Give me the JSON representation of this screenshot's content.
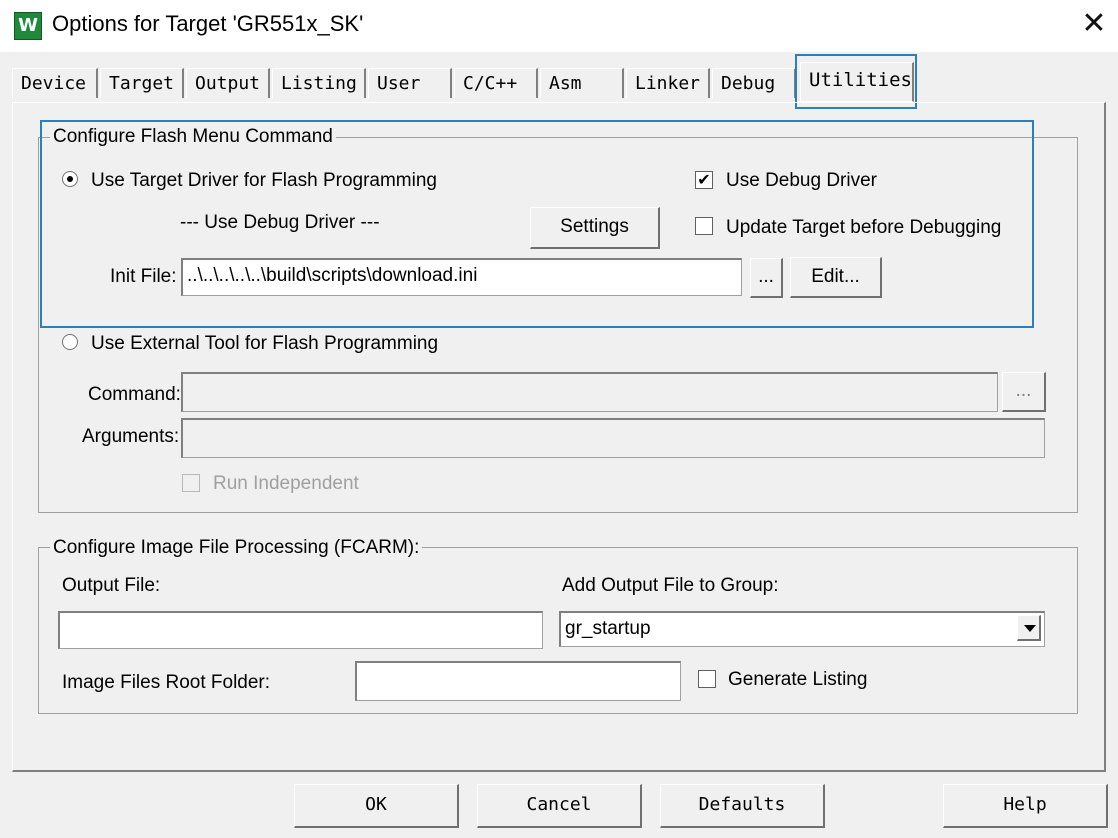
{
  "window": {
    "title": "Options for Target 'GR551x_SK'",
    "icon": "keil-uvision-icon",
    "close": "✕"
  },
  "tabs": [
    "Device",
    "Target",
    "Output",
    "Listing",
    "User",
    "C/C++",
    "Asm",
    "Linker",
    "Debug",
    "Utilities"
  ],
  "active_tab": "Utilities",
  "flash": {
    "group_title": "Configure Flash Menu Command",
    "use_target_driver_label": "Use Target Driver for Flash Programming",
    "use_target_driver_selected": true,
    "use_debug_driver_label": "Use Debug Driver",
    "use_debug_driver_checked": true,
    "debug_driver_select": "--- Use Debug Driver ---",
    "settings_label": "Settings",
    "update_target_label": "Update Target before Debugging",
    "update_target_checked": false,
    "init_file_label": "Init File:",
    "init_file_value": "..\\..\\..\\..\\..\\build\\scripts\\download.ini",
    "browse_label": "...",
    "edit_label": "Edit...",
    "use_external_label": "Use External Tool for Flash Programming",
    "use_external_selected": false,
    "command_label": "Command:",
    "command_value": "",
    "command_browse_label": "...",
    "arguments_label": "Arguments:",
    "arguments_value": "",
    "run_independent_label": "Run Independent",
    "run_independent_checked": false
  },
  "image": {
    "group_title": "Configure Image File Processing (FCARM):",
    "output_file_label": "Output File:",
    "output_file_value": "",
    "add_output_label": "Add Output File  to Group:",
    "group_value": "gr_startup",
    "root_folder_label": "Image Files Root Folder:",
    "root_folder_value": "",
    "generate_listing_label": "Generate Listing",
    "generate_listing_checked": false
  },
  "buttons": {
    "ok": "OK",
    "cancel": "Cancel",
    "defaults": "Defaults",
    "help": "Help"
  },
  "colors": {
    "highlight": "#2a7fbf",
    "background": "#f0f0f0",
    "icon_green": "#1f8a3c"
  }
}
